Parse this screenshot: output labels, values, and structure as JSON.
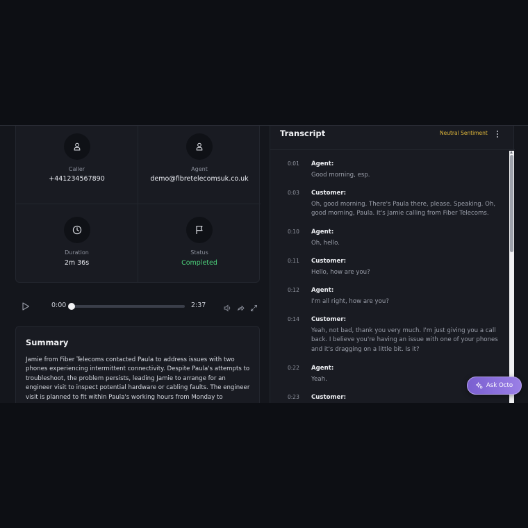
{
  "info": {
    "caller": {
      "label": "Caller",
      "value": "+441234567890",
      "icon": "user-icon"
    },
    "agent": {
      "label": "Agent",
      "value": "demo@fibretelecomsuk.co.uk",
      "icon": "user-icon"
    },
    "duration": {
      "label": "Duration",
      "value": "2m 36s",
      "icon": "clock-icon"
    },
    "status": {
      "label": "Status",
      "value": "Completed",
      "icon": "flag-icon",
      "color": "#4ccf7a"
    }
  },
  "player": {
    "current_time": "0:00",
    "total_time": "2:37",
    "progress": 0
  },
  "summary": {
    "title": "Summary",
    "text": "Jamie from Fiber Telecoms contacted Paula to address issues with two phones experiencing intermittent connectivity. Despite Paula's attempts to troubleshoot, the problem persists, leading Jamie to arrange for an engineer visit to inspect potential hardware or cabling faults. The engineer visit is planned to fit within Paula's working hours from Monday to Thursday."
  },
  "transcript": {
    "title": "Transcript",
    "sentiment": "Neutral Sentiment",
    "sentiment_color": "#e2b93b",
    "entries": [
      {
        "time": "0:01",
        "speaker": "Agent:",
        "text": "Good morning, esp."
      },
      {
        "time": "0:03",
        "speaker": "Customer:",
        "text": "Oh, good morning. There's Paula there, please. Speaking. Oh, good morning, Paula. It's Jamie calling from Fiber Telecoms."
      },
      {
        "time": "0:10",
        "speaker": "Agent:",
        "text": "Oh, hello."
      },
      {
        "time": "0:11",
        "speaker": "Customer:",
        "text": "Hello, how are you?"
      },
      {
        "time": "0:12",
        "speaker": "Agent:",
        "text": "I'm all right, how are you?"
      },
      {
        "time": "0:14",
        "speaker": "Customer:",
        "text": "Yeah, not bad, thank you very much. I'm just giving you a call back. I believe you're having an issue with one of your phones and it's dragging on a little bit. Is it?"
      },
      {
        "time": "0:22",
        "speaker": "Agent:",
        "text": "Yeah."
      },
      {
        "time": "0:23",
        "speaker": "Customer:",
        "text": ""
      }
    ]
  },
  "ask_octo": {
    "label": "Ask Octo",
    "icon": "sparkle-icon"
  }
}
